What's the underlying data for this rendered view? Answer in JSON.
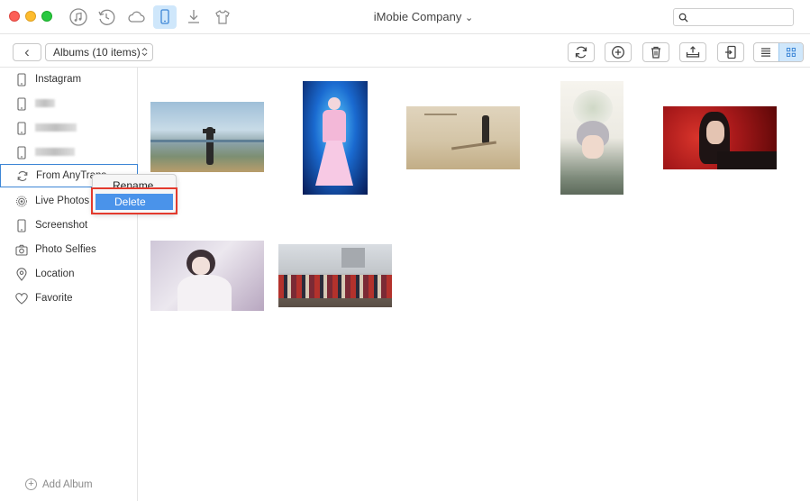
{
  "window": {
    "title": "iMobie Company",
    "title_chevron": "⌄"
  },
  "titlebar_icons": [
    "music-icon",
    "history-icon",
    "cloud-icon",
    "phone-icon",
    "download-icon",
    "tshirt-icon"
  ],
  "search": {
    "placeholder": ""
  },
  "toolbar": {
    "back_glyph": "‹",
    "album_select": "Albums (10 items)",
    "album_select_chevron": "⌃⌄"
  },
  "sidebar": {
    "items": [
      {
        "label": "Instagram",
        "icon": "phone-icon"
      },
      {
        "label": "",
        "icon": "phone-icon",
        "blurred": true
      },
      {
        "label": "",
        "icon": "phone-icon",
        "blurred": true
      },
      {
        "label": "",
        "icon": "phone-icon",
        "blurred": true
      },
      {
        "label": "From AnyTrans",
        "icon": "sync-icon",
        "selected": true
      },
      {
        "label": "Live Photos",
        "icon": "live-photo-icon"
      },
      {
        "label": "Screenshot",
        "icon": "phone-icon"
      },
      {
        "label": "Photo Selfies",
        "icon": "camera-icon"
      },
      {
        "label": "Location",
        "icon": "location-pin-icon"
      },
      {
        "label": "Favorite",
        "icon": "heart-icon"
      }
    ],
    "add_album": "Add Album"
  },
  "context_menu": {
    "items": [
      "Rename",
      "Delete"
    ],
    "highlighted": "Delete"
  },
  "colors": {
    "accent": "#4a93ea",
    "highlight_box": "#e33a2d",
    "active_tab_bg": "#cfe7fb"
  }
}
